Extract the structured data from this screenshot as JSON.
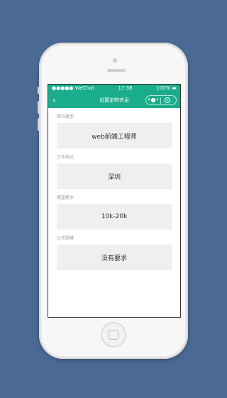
{
  "statusbar": {
    "signal": "●●●●● WeChat",
    "time": "17:38",
    "battery": "100% ▬"
  },
  "navbar": {
    "title": "设置定制信息",
    "back": "‹",
    "menu_dots": "•●•"
  },
  "fields": [
    {
      "label": "职位类型",
      "value": "web前端工程师"
    },
    {
      "label": "工作地点",
      "value": "深圳"
    },
    {
      "label": "期望薪水",
      "value": "10k-20k"
    },
    {
      "label": "公司规模",
      "value": "没有要求"
    }
  ],
  "colors": {
    "background": "#4a6a95",
    "accent": "#1aad8b",
    "field_bg": "#efefef"
  },
  "icons": [
    "back-arrow-icon",
    "more-dots-icon",
    "close-circle-icon",
    "wifi-icon",
    "battery-icon"
  ]
}
